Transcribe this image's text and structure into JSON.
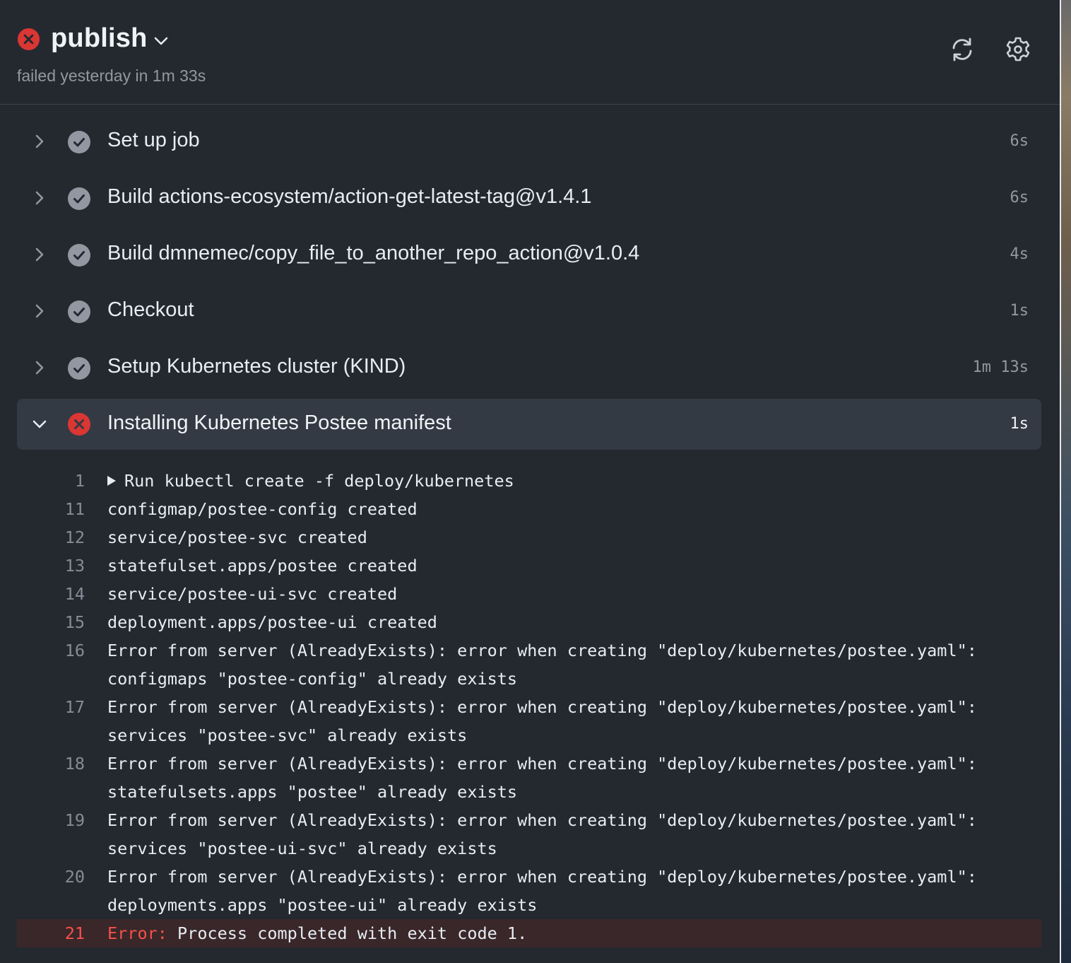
{
  "header": {
    "title": "publish",
    "subtitle": "failed yesterday in 1m 33s",
    "status": "failed",
    "refresh_icon": "refresh-icon",
    "settings_icon": "gear-icon"
  },
  "colors": {
    "background": "#24292f",
    "fail": "#da3633",
    "success_bg": "#9198a1",
    "error_row": "#3a272a",
    "expanded_row": "#343a44"
  },
  "steps": [
    {
      "name": "Set up job",
      "duration": "6s",
      "status": "success"
    },
    {
      "name": "Build actions-ecosystem/action-get-latest-tag@v1.4.1",
      "duration": "6s",
      "status": "success"
    },
    {
      "name": "Build dmnemec/copy_file_to_another_repo_action@v1.0.4",
      "duration": "4s",
      "status": "success"
    },
    {
      "name": "Checkout",
      "duration": "1s",
      "status": "success"
    },
    {
      "name": "Setup Kubernetes cluster (KIND)",
      "duration": "1m 13s",
      "status": "success"
    },
    {
      "name": "Installing Kubernetes Postee manifest",
      "duration": "1s",
      "status": "failed",
      "expanded": true
    }
  ],
  "log": [
    {
      "num": "1",
      "text": "Run kubectl create -f deploy/kubernetes",
      "collapsible": true
    },
    {
      "num": "11",
      "text": "configmap/postee-config created"
    },
    {
      "num": "12",
      "text": "service/postee-svc created"
    },
    {
      "num": "13",
      "text": "statefulset.apps/postee created"
    },
    {
      "num": "14",
      "text": "service/postee-ui-svc created"
    },
    {
      "num": "15",
      "text": "deployment.apps/postee-ui created"
    },
    {
      "num": "16",
      "text": "Error from server (AlreadyExists): error when creating \"deploy/kubernetes/postee.yaml\":\nconfigmaps \"postee-config\" already exists"
    },
    {
      "num": "17",
      "text": "Error from server (AlreadyExists): error when creating \"deploy/kubernetes/postee.yaml\":\nservices \"postee-svc\" already exists"
    },
    {
      "num": "18",
      "text": "Error from server (AlreadyExists): error when creating \"deploy/kubernetes/postee.yaml\":\nstatefulsets.apps \"postee\" already exists"
    },
    {
      "num": "19",
      "text": "Error from server (AlreadyExists): error when creating \"deploy/kubernetes/postee.yaml\":\nservices \"postee-ui-svc\" already exists"
    },
    {
      "num": "20",
      "text": "Error from server (AlreadyExists): error when creating \"deploy/kubernetes/postee.yaml\":\ndeployments.apps \"postee-ui\" already exists"
    },
    {
      "num": "21",
      "label": "Error:",
      "text": " Process completed with exit code 1.",
      "error": true
    }
  ]
}
